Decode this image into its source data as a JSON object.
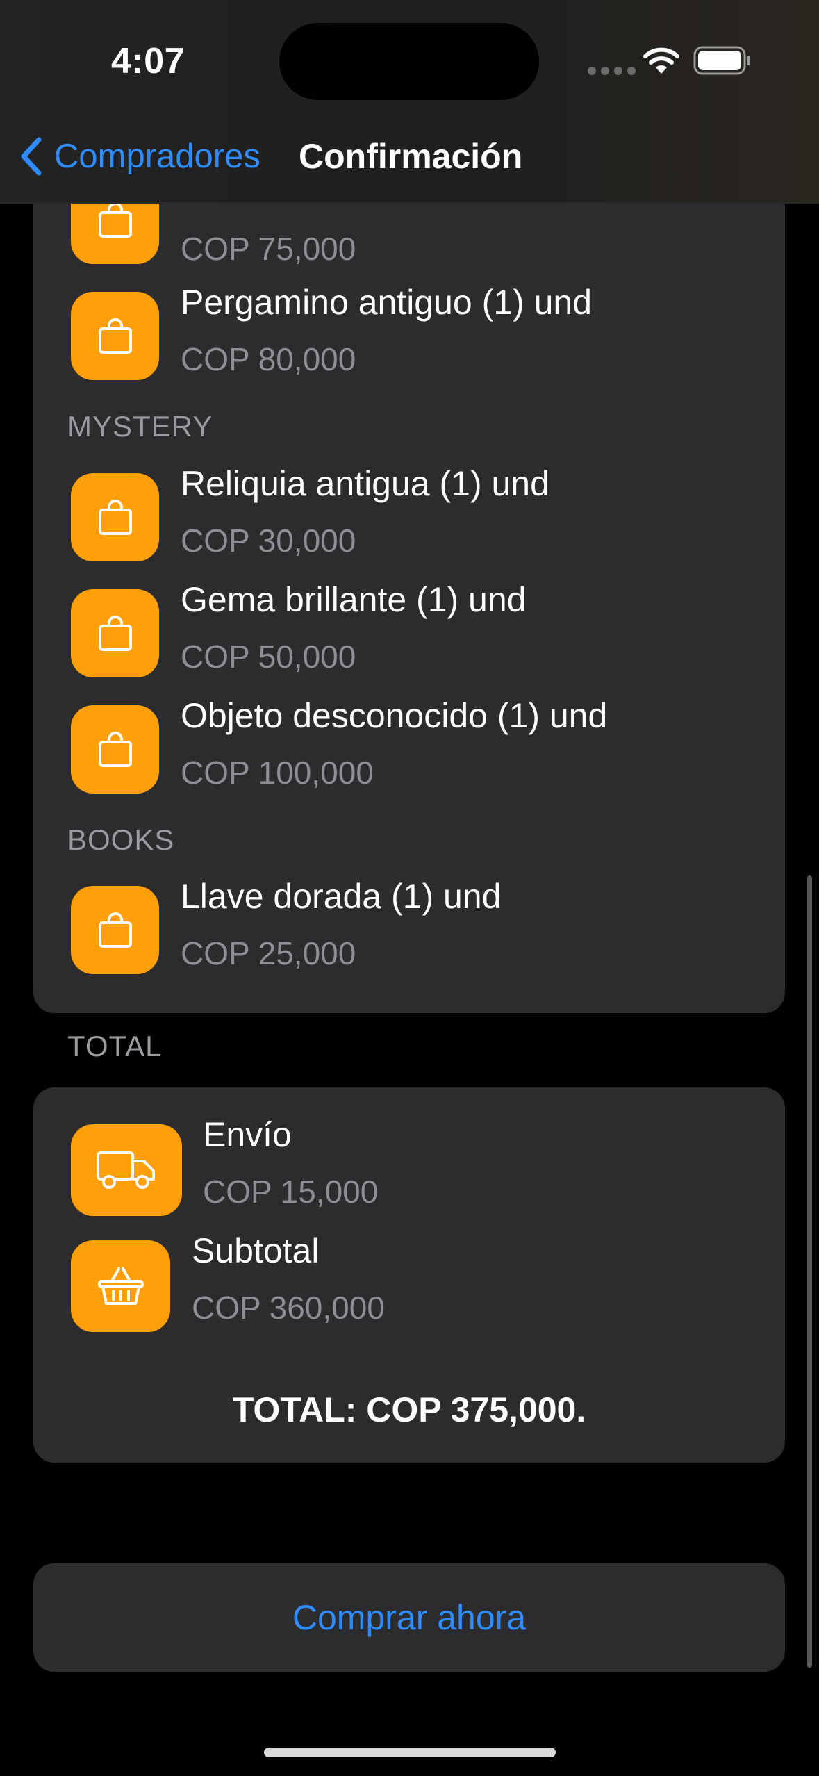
{
  "status_bar": {
    "time": "4:07"
  },
  "nav": {
    "back_label": "Compradores",
    "title": "Confirmación"
  },
  "partial_item": {
    "subtitle": "COP 75,000"
  },
  "items_top": [
    {
      "title": "Pergamino antiguo (1) und",
      "subtitle": "COP 80,000",
      "icon": "bag-icon"
    }
  ],
  "section_mystery": {
    "header": "MYSTERY",
    "items": [
      {
        "title": "Reliquia antigua (1) und",
        "subtitle": "COP 30,000",
        "icon": "bag-icon"
      },
      {
        "title": "Gema brillante (1) und",
        "subtitle": "COP 50,000",
        "icon": "bag-icon"
      },
      {
        "title": "Objeto desconocido (1) und",
        "subtitle": "COP 100,000",
        "icon": "bag-icon"
      }
    ]
  },
  "section_books": {
    "header": "BOOKS",
    "items": [
      {
        "title": "Llave dorada (1) und",
        "subtitle": "COP 25,000",
        "icon": "bag-icon"
      }
    ]
  },
  "total_section": {
    "header": "TOTAL",
    "shipping": {
      "title": "Envío",
      "subtitle": "COP 15,000",
      "icon": "truck-icon"
    },
    "subtotal": {
      "title": "Subtotal",
      "subtitle": "COP 360,000",
      "icon": "basket-icon"
    },
    "total_text": "TOTAL: COP 375,000."
  },
  "buy_button": {
    "label": "Comprar ahora"
  },
  "colors": {
    "accent": "#2f8cff",
    "icon_bg": "#ff9f0a",
    "card_bg": "#2c2c2e",
    "secondary_text": "#8e8e93"
  }
}
